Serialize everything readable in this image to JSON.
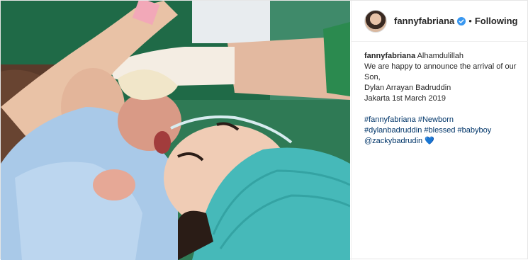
{
  "post": {
    "username": "fannyfabriana",
    "separator": "•",
    "follow_status": "Following",
    "caption": {
      "username": "fannyfabriana",
      "first_line": "Alhamdulillah",
      "lines": [
        "We are happy to announce the arrival of our Son,",
        "Dylan Arrayan Badruddin",
        "Jakarta 1st March 2019"
      ],
      "hashtags_line1": "#fannyfabriana #Newborn",
      "hashtags_line2": "#dylanbadruddin #blessed #babyboy",
      "mention": "@zackybadrudin",
      "emoji": "💙"
    },
    "icons": {
      "verified": "verified-badge-icon",
      "avatar": "profile-avatar"
    },
    "colors": {
      "link": "#003569",
      "verified": "#3897f0",
      "heart": "#1da1f2"
    }
  }
}
